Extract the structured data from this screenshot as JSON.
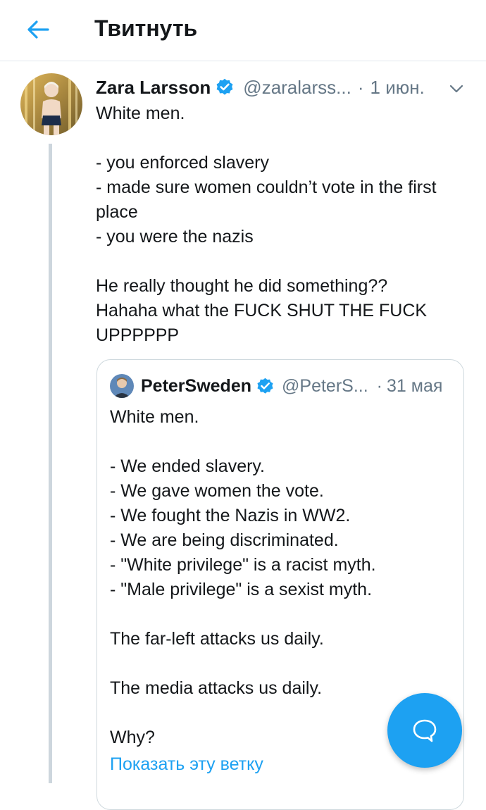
{
  "colors": {
    "accent": "#1da1f2",
    "text": "#14171a",
    "muted": "#657786",
    "border": "#e1e8ed"
  },
  "header": {
    "title": "Твитнуть",
    "back_icon": "arrow-left-icon"
  },
  "tweet": {
    "author_name": "Zara Larsson",
    "handle": "@zaralarss...",
    "separator": "·",
    "date": "1 июн.",
    "verified": true,
    "text": "White men.\n\n- you enforced slavery\n- made sure women couldn’t vote in the first place\n- you were the nazis\n\nHe really thought he did something??\nHahaha what the FUCK SHUT THE FUCK UPPPPPP"
  },
  "quoted": {
    "author_name": "PeterSweden",
    "handle": "@PeterS...",
    "separator": "·",
    "date": "31 мая",
    "verified": true,
    "text": "White men.\n\n- We ended slavery.\n- We gave women the vote.\n- We fought the Nazis in WW2.\n- We are being discriminated.\n- \"White privilege\" is a racist myth.\n- \"Male privilege\" is a sexist myth.\n\nThe far-left attacks us daily.\n\nThe media attacks us daily.\n\nWhy?",
    "show_thread": "Показать эту ветку"
  },
  "fab": {
    "icon": "reply-bubble-icon"
  }
}
